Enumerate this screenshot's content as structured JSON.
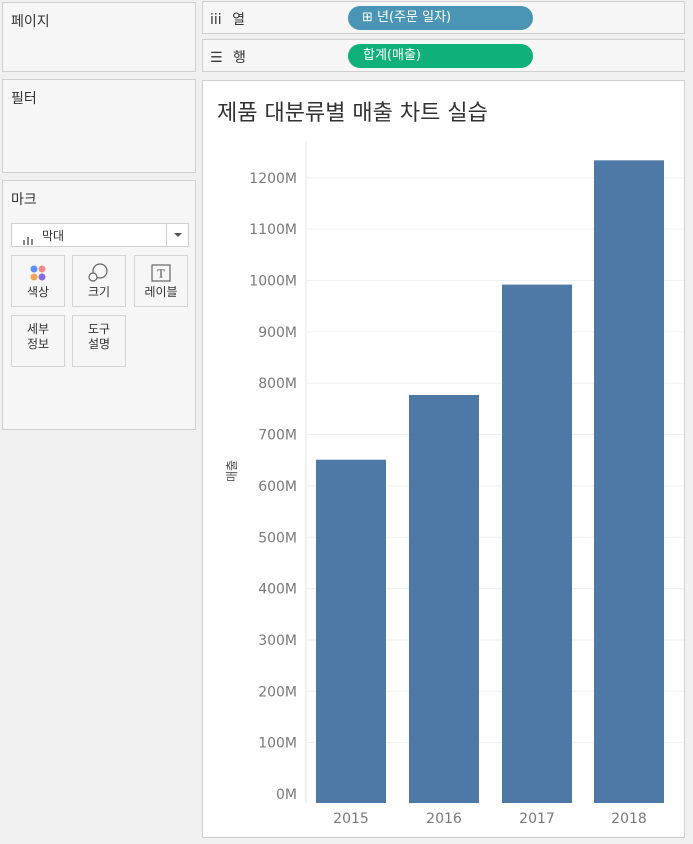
{
  "panels": {
    "pages_title": "페이지",
    "filters_title": "필터",
    "marks_title": "마크"
  },
  "marks": {
    "type_label": "막대",
    "buttons": [
      {
        "label": "색상",
        "icon": "color-dots-icon"
      },
      {
        "label": "크기",
        "icon": "size-icon"
      },
      {
        "label": "레이블",
        "icon": "label-text-icon"
      },
      {
        "label": "세부\n정보",
        "icon": ""
      },
      {
        "label": "도구\n설명",
        "icon": ""
      }
    ]
  },
  "shelves": {
    "columns_label": "열",
    "columns_icon": "columns-icon",
    "rows_label": "행",
    "rows_icon": "rows-icon",
    "columns_pill": "⊞ 년(주문 일자)",
    "rows_pill": "합계(매출)"
  },
  "viz": {
    "title": "제품 대분류별 매출 차트 실습"
  },
  "chart_data": {
    "type": "bar",
    "title": "제품 대분류별 매출 차트 실습",
    "xlabel": "",
    "ylabel": "매출",
    "categories": [
      "2015",
      "2016",
      "2017",
      "2018"
    ],
    "values": [
      651000000,
      777000000,
      992000000,
      1234000000
    ],
    "ylim": [
      0,
      1300000000
    ],
    "yticks": [
      "0M",
      "100M",
      "200M",
      "300M",
      "400M",
      "500M",
      "600M",
      "700M",
      "800M",
      "900M",
      "1000M",
      "1100M",
      "1200M"
    ],
    "bar_color": "#4e79a7",
    "grid": true
  }
}
